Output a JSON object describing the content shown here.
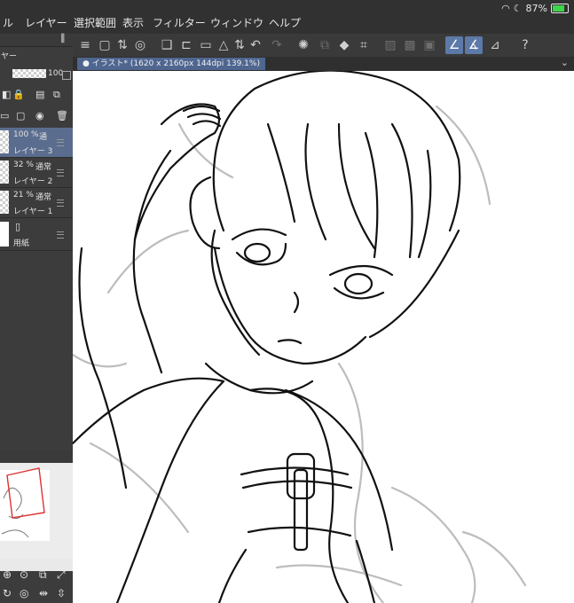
{
  "status": {
    "battery": "87%"
  },
  "menu": [
    "ル",
    "レイヤー",
    "選択範囲",
    "表示",
    "フィルター",
    "ウィンドウ",
    "ヘルプ"
  ],
  "canvas": {
    "tab_title": "● イラスト* (1620 x 2160px 144dpi 139.1%)"
  },
  "layers_panel": {
    "header": "ヤー",
    "opacity_value": "100",
    "layers": [
      {
        "percent": "100 %",
        "mode": "通",
        "name": "レイヤー 3",
        "selected": true
      },
      {
        "percent": "32 %",
        "mode": "通常",
        "name": "レイヤー 2",
        "selected": false
      },
      {
        "percent": "21 %",
        "mode": "通常",
        "name": "レイヤー 1",
        "selected": false
      },
      {
        "percent": "",
        "mode": "",
        "name": "用紙",
        "selected": false
      }
    ]
  },
  "icons": [
    "wifi-icon",
    "moon-icon",
    "battery-icon",
    "menu-icon",
    "undo-icon",
    "redo-icon",
    "help-icon"
  ],
  "colors": {
    "accent": "#5d79a8",
    "selected_layer": "#5a6d8f",
    "battery": "#3ed64b"
  }
}
